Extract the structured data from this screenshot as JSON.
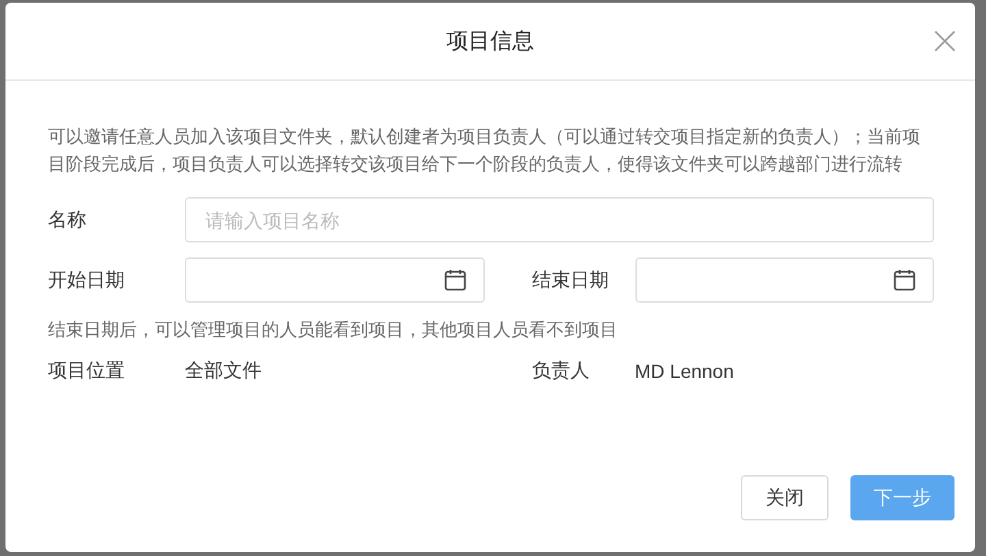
{
  "dialog": {
    "title": "项目信息",
    "description": "可以邀请任意人员加入该项目文件夹，默认创建者为项目负责人（可以通过转交项目指定新的负责人）；当前项目阶段完成后，项目负责人可以选择转交该项目给下一个阶段的负责人，使得该文件夹可以跨越部门进行流转",
    "name_field": {
      "label": "名称",
      "placeholder": "请输入项目名称"
    },
    "start_date": {
      "label": "开始日期"
    },
    "end_date": {
      "label": "结束日期"
    },
    "note": "结束日期后，可以管理项目的人员能看到项目，其他项目人员看不到项目",
    "location": {
      "label": "项目位置",
      "value": "全部文件"
    },
    "owner": {
      "label": "负责人",
      "value": "MD Lennon"
    },
    "buttons": [
      {
        "label": "关闭",
        "kind": "default"
      },
      {
        "label": "下一步",
        "kind": "primary"
      }
    ]
  }
}
